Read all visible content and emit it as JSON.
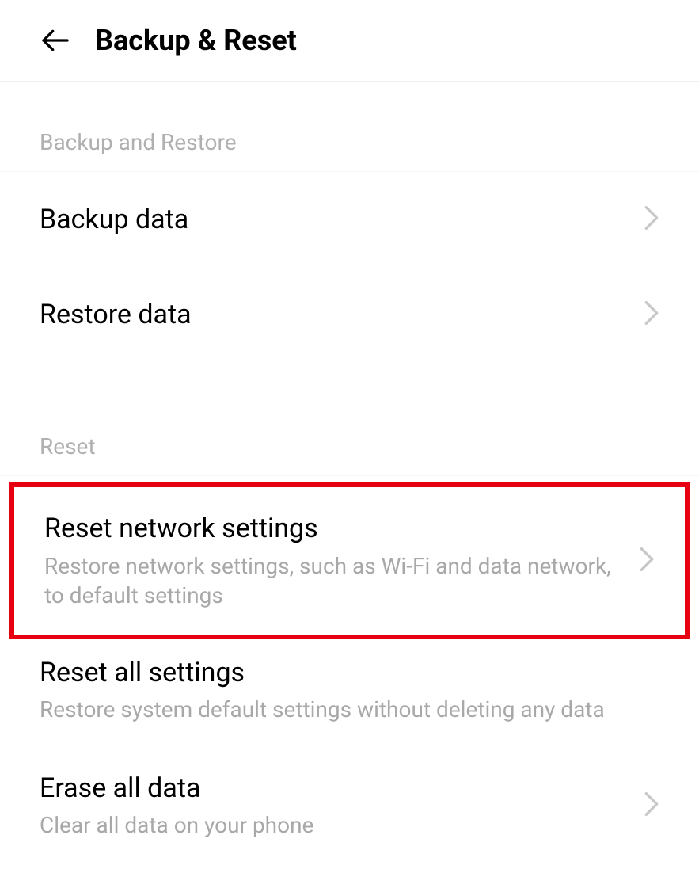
{
  "header": {
    "title": "Backup & Reset"
  },
  "sections": {
    "backup_restore": {
      "header": "Backup and Restore",
      "items": {
        "backup_data": {
          "title": "Backup data"
        },
        "restore_data": {
          "title": "Restore data"
        }
      }
    },
    "reset": {
      "header": "Reset",
      "items": {
        "reset_network": {
          "title": "Reset network settings",
          "subtitle": "Restore network settings, such as Wi-Fi and data network, to default settings"
        },
        "reset_all": {
          "title": "Reset all settings",
          "subtitle": "Restore system default settings without deleting any data"
        },
        "erase_all": {
          "title": "Erase all data",
          "subtitle": "Clear all data on your phone"
        }
      }
    }
  }
}
